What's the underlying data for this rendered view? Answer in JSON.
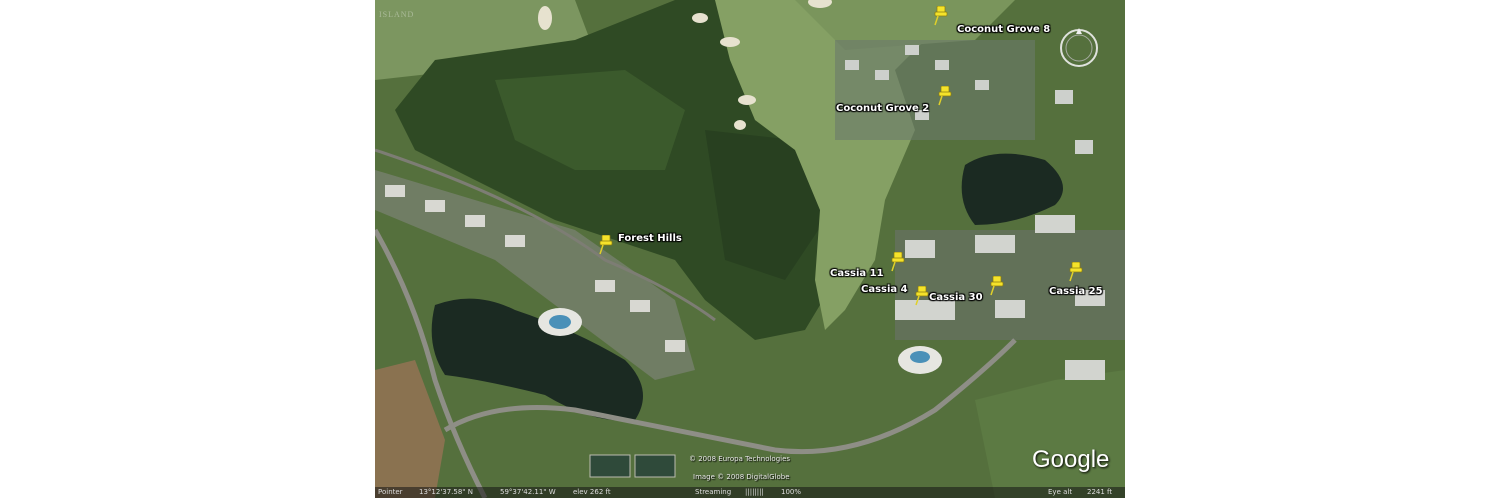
{
  "placemarks": [
    {
      "label": "Coconut Grove 8"
    },
    {
      "label": "Coconut Grove 2"
    },
    {
      "label": "Forest Hills"
    },
    {
      "label": "Cassia 11"
    },
    {
      "label": "Cassia 4"
    },
    {
      "label": "Cassia 30"
    },
    {
      "label": "Cassia 25"
    }
  ],
  "attribution": {
    "europa": "© 2008 Europa Technologies",
    "digitalglobe": "Image © 2008 DigitalGlobe",
    "logo": "Google"
  },
  "status": {
    "pointer_label": "Pointer",
    "latitude": "13°12'37.58\" N",
    "longitude": "59°37'42.11\" W",
    "elevation": "elev  262 ft",
    "streaming_label": "Streaming",
    "streaming_bars": "||||||||",
    "streaming_pct": "100%",
    "eye_alt_label": "Eye alt",
    "eye_alt_value": "2241 ft"
  },
  "watermark": "ISLAND",
  "colors": {
    "pin": "#f5e32a",
    "forest": "#2f4a24",
    "fairway": "#7f9a5e",
    "water": "#1b2a22"
  },
  "icons": {
    "placemark": "yellow-pushpin-icon",
    "navigation": "compass-ring-icon"
  }
}
